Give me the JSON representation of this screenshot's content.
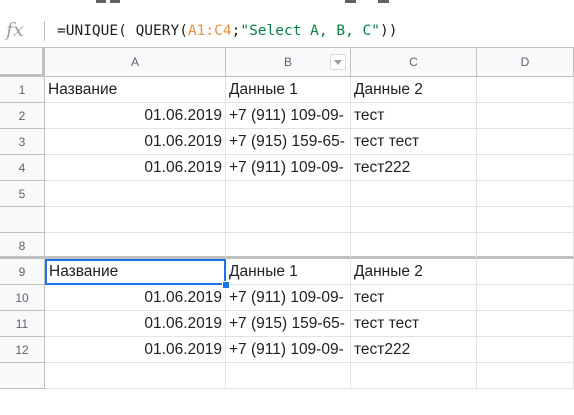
{
  "formula_bar": {
    "icon": "fx-icon",
    "formula_prefix": "=UNIQUE( QUERY(",
    "formula_range": "A1:C4",
    "formula_sep": ";",
    "formula_string": "\"Select A, B, C\"",
    "formula_suffix": "))"
  },
  "columns": [
    {
      "key": "A",
      "label": "A"
    },
    {
      "key": "B",
      "label": "B"
    },
    {
      "key": "C",
      "label": "C"
    },
    {
      "key": "D",
      "label": "D"
    }
  ],
  "rows": [
    {
      "num": "1",
      "cells": [
        "Название",
        "Данные 1",
        "Данные 2",
        ""
      ]
    },
    {
      "num": "2",
      "cells": [
        "01.06.2019",
        "+7 (911) 109-09-",
        "тест",
        ""
      ]
    },
    {
      "num": "3",
      "cells": [
        "01.06.2019",
        "+7 (915) 159-65-",
        "тест тест",
        ""
      ]
    },
    {
      "num": "4",
      "cells": [
        "01.06.2019",
        "+7 (911) 109-09-",
        "тест222",
        ""
      ]
    },
    {
      "num": "5",
      "cells": [
        "",
        "",
        "",
        ""
      ]
    },
    {
      "num": "",
      "cells": [
        "",
        "",
        "",
        ""
      ]
    },
    {
      "num": "8",
      "cells": [
        "",
        "",
        "",
        ""
      ]
    },
    {
      "num": "9",
      "cells": [
        "Название",
        "Данные 1",
        "Данные 2",
        ""
      ]
    },
    {
      "num": "10",
      "cells": [
        "01.06.2019",
        "+7 (911) 109-09-",
        "тест",
        ""
      ]
    },
    {
      "num": "11",
      "cells": [
        "01.06.2019",
        "+7 (915) 159-65-",
        "тест тест",
        ""
      ]
    },
    {
      "num": "12",
      "cells": [
        "01.06.2019",
        "+7 (911) 109-09-",
        "тест222",
        ""
      ]
    },
    {
      "num": "",
      "cells": [
        "",
        "",
        "",
        ""
      ]
    }
  ],
  "selected_cell": "A9",
  "colors": {
    "selection": "#1a73e8",
    "range_ref": "#e69138",
    "string_literal": "#0b8043"
  }
}
